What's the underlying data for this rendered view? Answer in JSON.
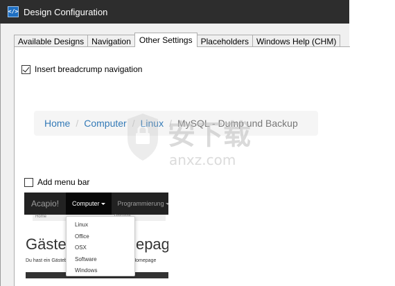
{
  "window": {
    "title": "Design Configuration",
    "icon": "code-tag-icon",
    "icon_glyph": "</>"
  },
  "tabs": [
    {
      "label": "Available Designs",
      "active": false
    },
    {
      "label": "Navigation",
      "active": false
    },
    {
      "label": "Other Settings",
      "active": true
    },
    {
      "label": "Placeholders",
      "active": false
    },
    {
      "label": "Windows Help (CHM)",
      "active": false
    }
  ],
  "settings": {
    "breadcrumb_checkbox": {
      "label": "Insert breadcrump navigation",
      "checked": true
    },
    "menubar_checkbox": {
      "label": "Add menu bar",
      "checked": false
    }
  },
  "breadcrumb_preview": {
    "items": [
      "Home",
      "Computer",
      "Linux"
    ],
    "separator": "/",
    "active": "MySQL - Dump und Backup"
  },
  "menu_preview": {
    "brand": "Acapio!",
    "nav": [
      "Computer",
      "Programmierung"
    ],
    "subbar": [
      "Home",
      "Docuoch"
    ],
    "dropdown": [
      "Linux",
      "Office",
      "OSX",
      "Software",
      "Windows"
    ],
    "hero_title": "Gästebuch Homepage",
    "hero_text": "Du hast ein Gästebuch und möchtest es in Deine Homepage"
  },
  "watermark": {
    "text": "安下载",
    "sub": "anxz.com"
  },
  "colors": {
    "titlebar": "#2d2d2d",
    "link": "#337ab7",
    "navbar": "#222222"
  }
}
